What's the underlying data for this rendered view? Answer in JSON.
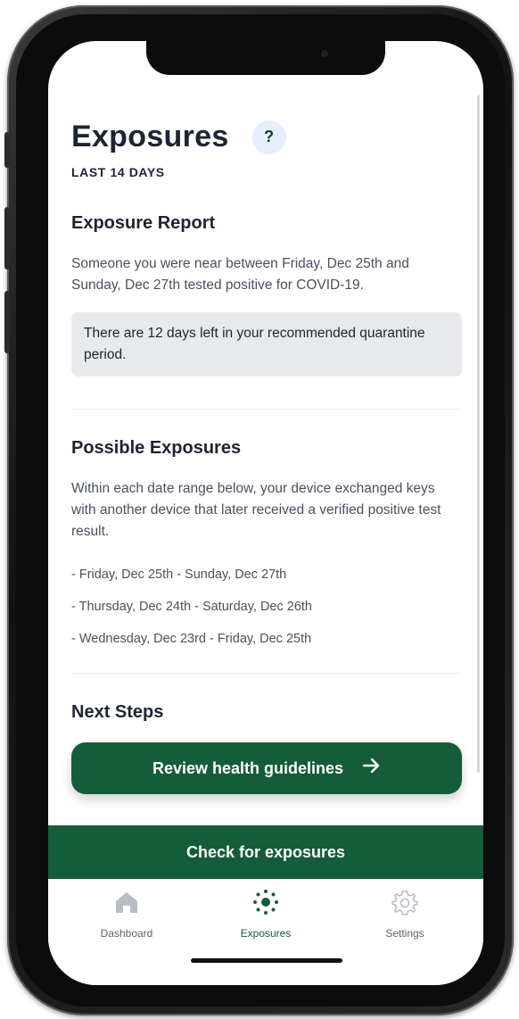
{
  "header": {
    "title": "Exposures",
    "help_label": "?",
    "subtitle": "LAST 14 DAYS"
  },
  "report": {
    "heading": "Exposure Report",
    "text": "Someone you were near between Friday, Dec 25th and Sunday, Dec 27th tested positive for COVID-19.",
    "notice": "There are 12 days left in your recommended quarantine period."
  },
  "possible": {
    "heading": "Possible Exposures",
    "text": "Within each date range below, your device exchanged keys with another device that later received a verified positive test result.",
    "ranges": [
      "- Friday, Dec 25th - Sunday, Dec 27th",
      "- Thursday, Dec 24th - Saturday, Dec 26th",
      "- Wednesday, Dec 23rd - Friday, Dec 25th"
    ]
  },
  "next": {
    "heading": "Next Steps",
    "button_label": "Review health guidelines",
    "button_icon": "arrow-right-icon"
  },
  "check_button_label": "Check for exposures",
  "tabs": [
    {
      "label": "Dashboard",
      "icon": "home-icon",
      "active": false
    },
    {
      "label": "Exposures",
      "icon": "exposure-dots-icon",
      "active": true
    },
    {
      "label": "Settings",
      "icon": "gear-icon",
      "active": false
    }
  ],
  "colors": {
    "primary": "#145c3a",
    "text": "#1d2433",
    "muted": "#4a5060",
    "notice_bg": "#e8e9ed",
    "help_bg": "#e6eefb"
  }
}
